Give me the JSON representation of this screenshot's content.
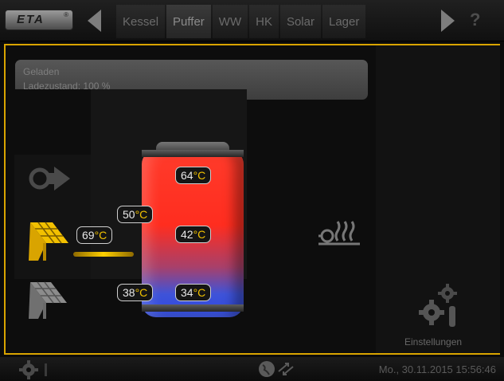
{
  "header": {
    "logo_text": "ETA",
    "logo_mark": "®",
    "tabs": [
      {
        "label": "Kessel",
        "active": false
      },
      {
        "label": "Puffer",
        "active": true
      },
      {
        "label": "WW",
        "active": false
      },
      {
        "label": "HK",
        "active": false
      },
      {
        "label": "Solar",
        "active": false
      },
      {
        "label": "Lager",
        "active": false
      }
    ],
    "help_label": "?"
  },
  "status": {
    "line1": "Geladen",
    "line2": "Ladezustand: 100 %"
  },
  "tank": {
    "temp_top": {
      "value": "64",
      "unit": "°C"
    },
    "temp_upper_left": {
      "value": "50",
      "unit": "°C"
    },
    "temp_middle": {
      "value": "42",
      "unit": "°C"
    },
    "temp_lower_left": {
      "value": "38",
      "unit": "°C"
    },
    "temp_bottom": {
      "value": "34",
      "unit": "°C"
    }
  },
  "solar": {
    "collector_temp": {
      "value": "69",
      "unit": "°C"
    }
  },
  "settings": {
    "label": "Einstellungen"
  },
  "footer": {
    "datetime": "Mo., 30.11.2015 15:56:46"
  },
  "colors": {
    "accent": "#d9a400",
    "temp_unit": "#f2c200",
    "hot": "#ff3b2b",
    "cold": "#2d48e0"
  },
  "icons": [
    "back-arrow-icon",
    "forward-arrow-icon",
    "help-icon",
    "heat-source-icon",
    "solar-collector-active-icon",
    "solar-collector-inactive-icon",
    "radiator-heating-icon",
    "settings-gears-icon",
    "service-gear-icon",
    "network-globe-icon"
  ]
}
